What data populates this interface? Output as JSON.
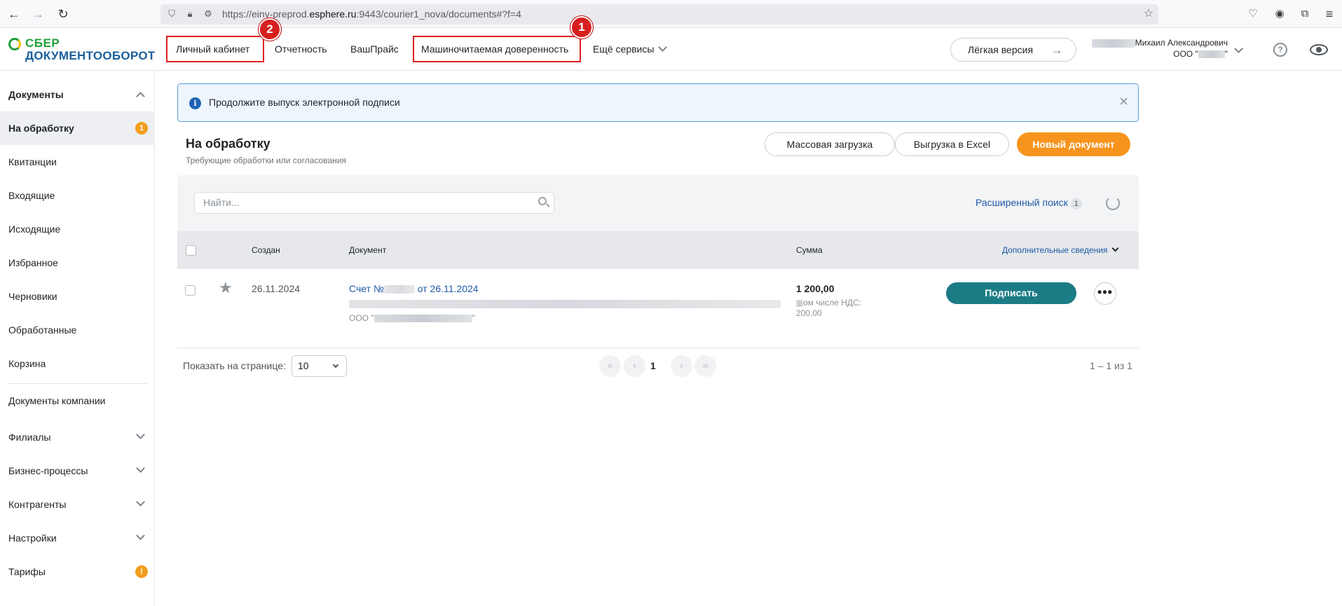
{
  "browser": {
    "url_prefix": "https://einv-preprod.",
    "url_host": "esphere.ru",
    "url_rest": ":9443/courier1_nova/documents#?f=4"
  },
  "header": {
    "logo_line1": "СБЕР",
    "logo_line2": "ДОКУМЕНТООБОРОТ",
    "nav": [
      {
        "label": "Личный кабинет"
      },
      {
        "label": "Отчетность"
      },
      {
        "label": "ВашПрайс"
      },
      {
        "label": "Машиночитаемая доверенность"
      },
      {
        "label": "Ещё сервисы"
      }
    ],
    "markers": [
      "2",
      "1"
    ],
    "light_version": "Лёгкая версия",
    "user_name": "Михаил Александрович",
    "user_org_prefix": "ООО \"",
    "user_org_suffix": "\"",
    "help_glyph": "?"
  },
  "sidebar": {
    "items": [
      {
        "label": "Документы"
      },
      {
        "label": "На обработку",
        "badge": "1"
      },
      {
        "label": "Квитанции"
      },
      {
        "label": "Входящие"
      },
      {
        "label": "Исходящие"
      },
      {
        "label": "Избранное"
      },
      {
        "label": "Черновики"
      },
      {
        "label": "Обработанные"
      },
      {
        "label": "Корзина"
      },
      {
        "label": "Документы компании"
      },
      {
        "label": "Филиалы"
      },
      {
        "label": "Бизнес-процессы"
      },
      {
        "label": "Контрагенты"
      },
      {
        "label": "Настройки"
      },
      {
        "label": "Тарифы",
        "badge": "!"
      }
    ]
  },
  "alert": {
    "icon": "i",
    "text": "Продолжите выпуск электронной подписи",
    "close": "×"
  },
  "page": {
    "title": "На обработку",
    "subtitle": "Требующие обработки или согласования",
    "mass_upload": "Массовая загрузка",
    "excel_export": "Выгрузка в Excel",
    "new_document": "Новый документ"
  },
  "search": {
    "placeholder": "Найти...",
    "advanced": "Расширенный поиск",
    "advanced_count": "1"
  },
  "table": {
    "columns": {
      "created": "Создан",
      "document": "Документ",
      "sum": "Сумма",
      "more_info": "Дополнительные сведения"
    },
    "rows": [
      {
        "created": "26.11.2024",
        "doc_prefix": "Счет №",
        "doc_suffix": " от 26.11.2024",
        "org_prefix": "ООО \"",
        "org_suffix": "\"",
        "sum": "1 200,00",
        "vat_label": "ом числе НДС:",
        "vat_value": "200,00",
        "sign": "Подписать",
        "more": "•••"
      }
    ]
  },
  "pager": {
    "label": "Показать на странице:",
    "per_page": "10",
    "current": "1",
    "total": "1 – 1 из 1",
    "first": "«",
    "prev": "‹",
    "next": "›",
    "last": "»"
  }
}
